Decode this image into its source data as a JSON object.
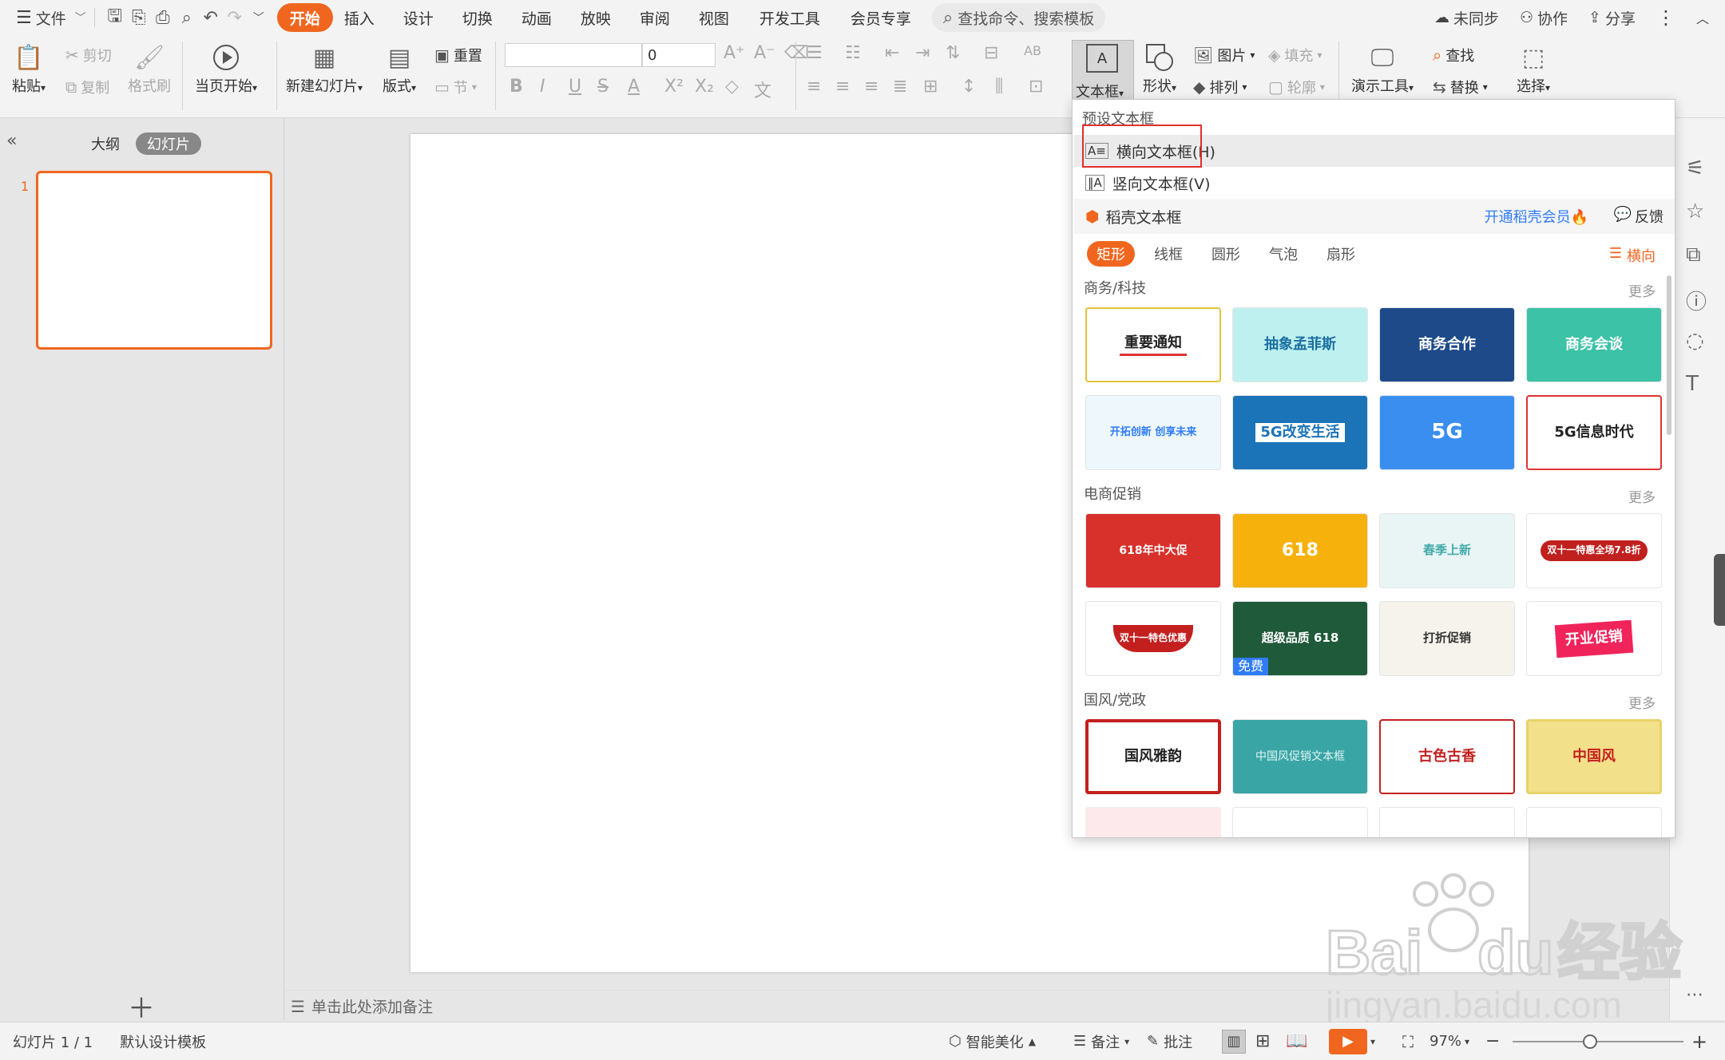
{
  "menu": {
    "file": "文件",
    "tabs": [
      "开始",
      "插入",
      "设计",
      "切换",
      "动画",
      "放映",
      "审阅",
      "视图",
      "开发工具",
      "会员专享"
    ],
    "search": "查找命令、搜索模板",
    "right": [
      "未同步",
      "协作",
      "分享"
    ]
  },
  "ribbon": {
    "paste": "粘贴",
    "cut": "剪切",
    "copy": "复制",
    "format_painter": "格式刷",
    "from_current": "当页开始",
    "new_slide": "新建幻灯片",
    "layout": "版式",
    "reset": "重置",
    "section": "节",
    "font_size": "0",
    "textbox": "文本框",
    "shape": "形状",
    "picture": "图片",
    "fill": "填充",
    "arrange": "排列",
    "outline": "轮廓",
    "present_tools": "演示工具",
    "find": "查找",
    "replace": "替换",
    "select": "选择"
  },
  "left_panel": {
    "outline_tab": "大纲",
    "slides_tab": "幻灯片",
    "slide_number": "1"
  },
  "notes": "单击此处添加备注",
  "status": {
    "slide_info": "幻灯片 1 / 1",
    "template": "默认设计模板",
    "beautify": "智能美化",
    "notes": "备注",
    "comments": "批注",
    "zoom": "97%"
  },
  "dropdown": {
    "preset_header": "预设文本框",
    "horizontal": "横向文本框(H)",
    "vertical": "竖向文本框(V)",
    "docer_header": "稻壳文本框",
    "open_member": "开通稻壳会员",
    "feedback": "反馈",
    "filter_tabs": [
      "矩形",
      "线框",
      "圆形",
      "气泡",
      "扇形"
    ],
    "orientation": "横向",
    "more": "更多",
    "categories": [
      {
        "name": "商务/科技",
        "tiles": [
          "重要通知",
          "抽象孟菲斯",
          "商务合作",
          "商务会谈",
          "开拓创新 创享未来",
          "5G改变生活",
          "5G",
          "5G信息时代"
        ]
      },
      {
        "name": "电商促销",
        "tiles": [
          "618年中大促",
          "618",
          "春季上新",
          "双十一特惠全场7.8折",
          "双十一特色优惠",
          "超级品质 618",
          "打折促销",
          "开业促销"
        ]
      },
      {
        "name": "国风/党政",
        "tiles": [
          "国风雅韵",
          "中国风促销文本框",
          "古色古香",
          "中国风"
        ]
      }
    ],
    "free_badge": "免费"
  },
  "colors": {
    "accent": "#f0661f",
    "highlight_box": "#e0302d",
    "member": "#2f7cf6"
  }
}
